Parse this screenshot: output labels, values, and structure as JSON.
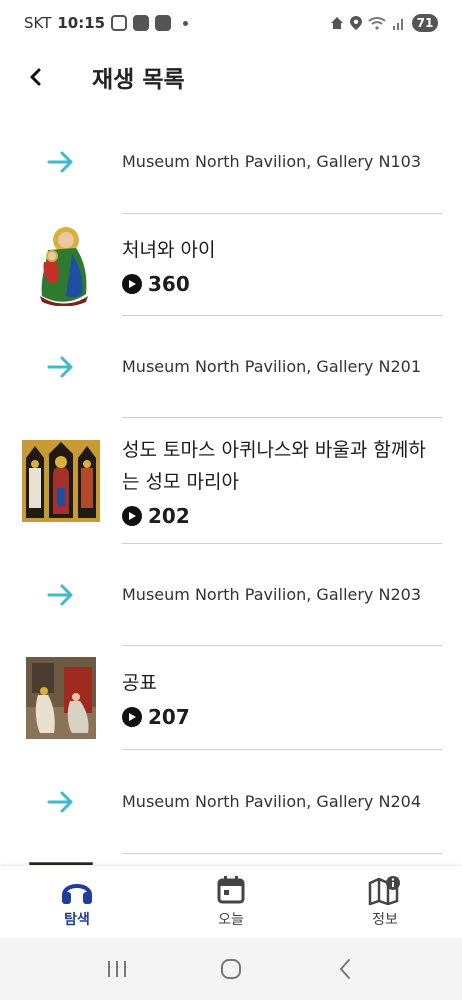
{
  "status_bar": {
    "carrier": "SKT",
    "time": "10:15",
    "battery": "71"
  },
  "header": {
    "title": "재생 목록"
  },
  "playlist": {
    "items": [
      {
        "kind": "location",
        "text": "Museum North Pavilion, Gallery N103"
      },
      {
        "kind": "stop",
        "title": "처녀와 아이",
        "number": "360"
      },
      {
        "kind": "location",
        "text": "Museum North Pavilion, Gallery N201"
      },
      {
        "kind": "stop",
        "title": "성도 토마스 아퀴나스와 바울과 함께하는 성모 마리아",
        "number": "202"
      },
      {
        "kind": "location",
        "text": "Museum North Pavilion, Gallery N203"
      },
      {
        "kind": "stop",
        "title": "공표",
        "number": "207"
      },
      {
        "kind": "location",
        "text": "Museum North Pavilion, Gallery N204"
      }
    ]
  },
  "bottom_nav": {
    "tabs": [
      {
        "label": "탐색",
        "icon": "headphones-icon",
        "active": true
      },
      {
        "label": "오늘",
        "icon": "calendar-icon",
        "active": false
      },
      {
        "label": "정보",
        "icon": "map-info-icon",
        "active": false
      }
    ]
  },
  "colors": {
    "accent_arrow": "#3fb8d0",
    "active_tab": "#1f3e9b"
  }
}
